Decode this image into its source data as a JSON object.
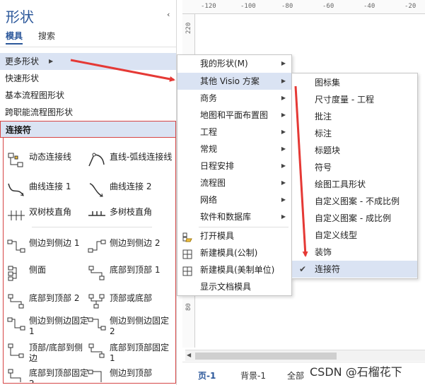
{
  "pane": {
    "title": "形状",
    "collapse_glyph": "‹",
    "tabs": [
      "模具",
      "搜索"
    ],
    "stencils": [
      "更多形状",
      "快速形状",
      "基本流程图形状",
      "跨职能流程图形状",
      "连接符"
    ],
    "shapes_col1": [
      "动态连接线",
      "曲线连接 1",
      "双树枝直角",
      "侧边到侧边 1",
      "侧面",
      "底部到顶部 2",
      "侧边到侧边固定 1",
      "顶部/底部到侧边",
      "底部到顶部固定 2"
    ],
    "shapes_col2": [
      "直线-弧线连接线",
      "曲线连接 2",
      "多树枝直角",
      "侧边到侧边 2",
      "底部到顶部 1",
      "顶部或底部",
      "侧边到侧边固定 2",
      "底部到顶部固定 1",
      "侧边到顶部"
    ]
  },
  "menu1": {
    "items": [
      "我的形状(M)",
      "其他 Visio 方案",
      "商务",
      "地图和平面布置图",
      "工程",
      "常规",
      "日程安排",
      "流程图",
      "网络",
      "软件和数据库"
    ],
    "actions": [
      "打开模具",
      "新建模具(公制)",
      "新建模具(美制单位)",
      "显示文档模具"
    ]
  },
  "menu2": {
    "items": [
      "图标集",
      "尺寸度量 - 工程",
      "批注",
      "标注",
      "标题块",
      "符号",
      "绘图工具形状",
      "自定义图案 - 不成比例",
      "自定义图案 - 成比例",
      "自定义线型",
      "装饰",
      "连接符"
    ]
  },
  "ruler": {
    "top_ticks": [
      "-120",
      "-100",
      "-80",
      "-60",
      "-40",
      "-20"
    ],
    "left_ticks": [
      "220",
      "80"
    ]
  },
  "status": {
    "tabs": [
      "页-1",
      "背景-1",
      "全部"
    ]
  },
  "watermark": "CSDN @石榴花下",
  "colors": {
    "accent": "#2b579a",
    "highlight": "#dae3f3",
    "annotation": "#e53935"
  }
}
